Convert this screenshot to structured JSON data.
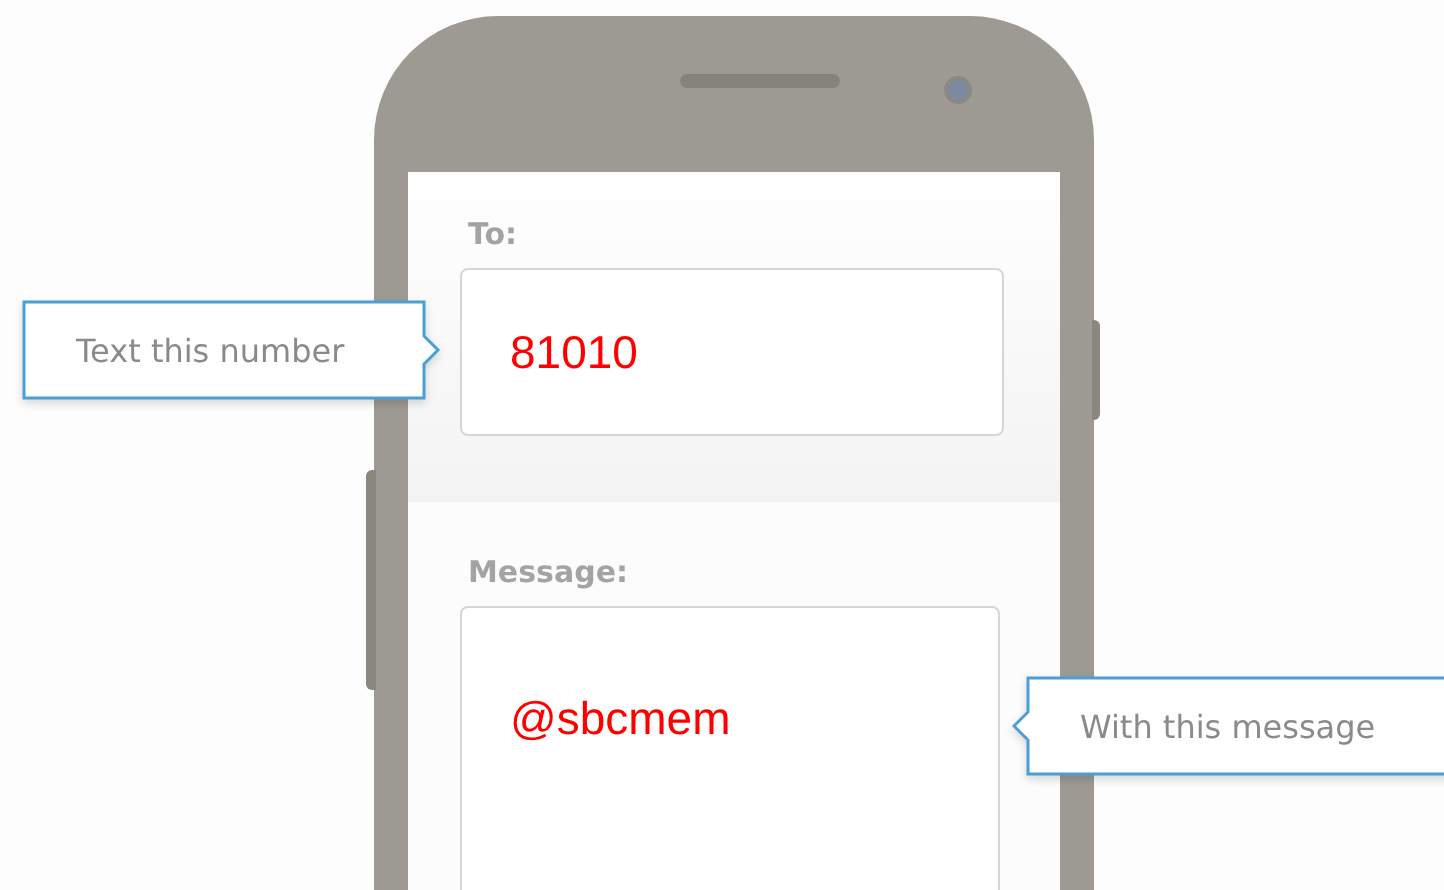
{
  "fields": [
    {
      "label": "To:",
      "value": "81010",
      "callout": {
        "text": "Text this number",
        "kind": "left"
      }
    },
    {
      "label": "Message:",
      "value": "@sbcmem",
      "callout": {
        "text": "With this message",
        "kind": "right"
      }
    }
  ]
}
